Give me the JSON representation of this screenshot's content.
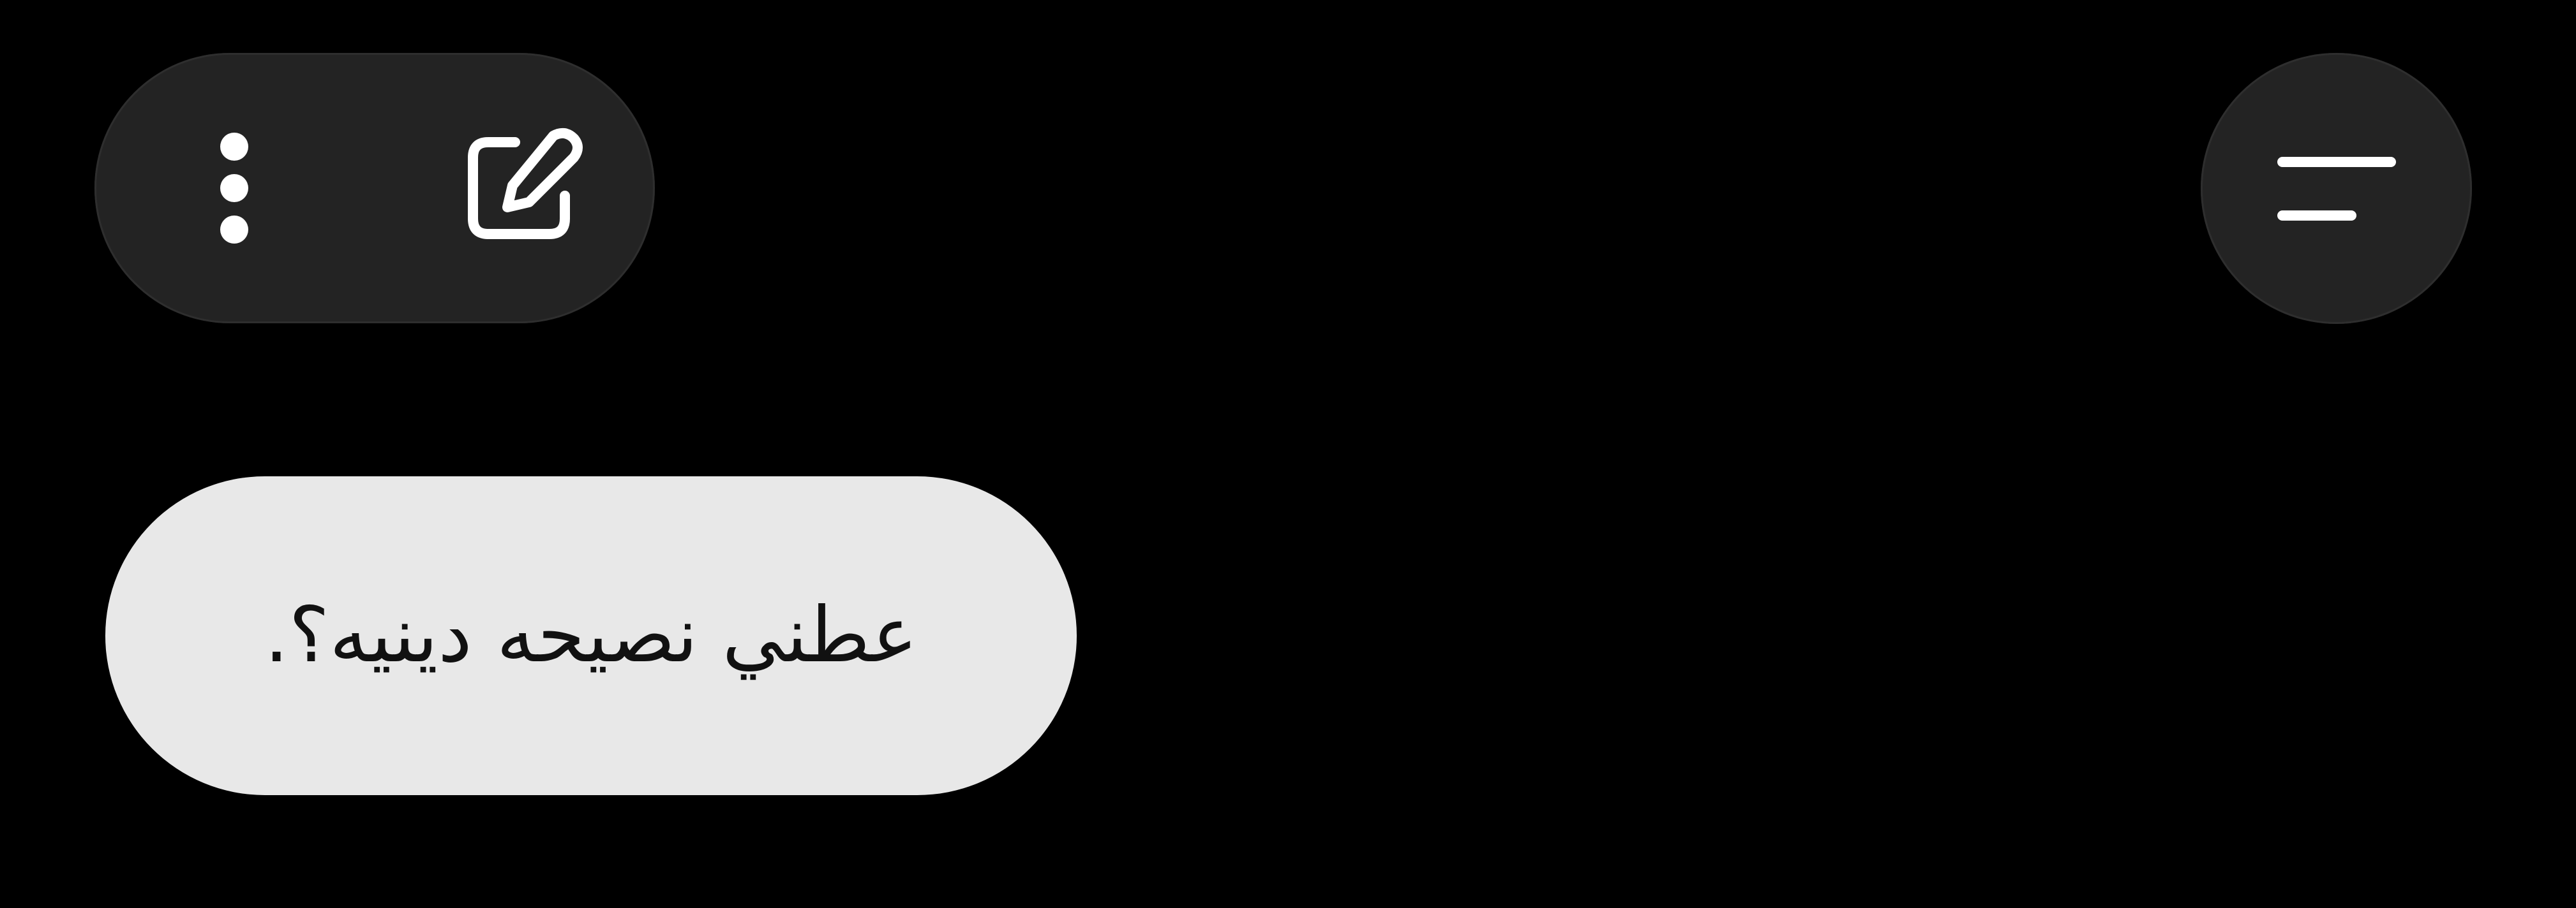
{
  "toolbar": {
    "more_icon": "more-vertical-icon",
    "edit_icon": "edit-note-icon",
    "menu_icon": "filter-menu-icon"
  },
  "messages": [
    {
      "role": "user",
      "text": "عطني نصيحه دينيه؟."
    }
  ],
  "colors": {
    "background": "#000000",
    "button_bg": "#232323",
    "icon": "#ffffff",
    "bubble_bg": "#e8e8e8",
    "bubble_text": "#111111"
  }
}
